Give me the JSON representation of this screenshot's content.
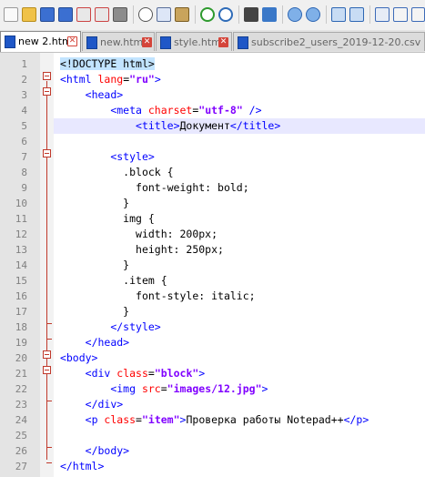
{
  "toolbar": {
    "icons": [
      "new-file",
      "open-file",
      "save",
      "save-all",
      "close",
      "close-all",
      "print",
      "cut",
      "copy",
      "paste",
      "undo",
      "redo",
      "find",
      "replace",
      "zoom-in",
      "zoom-out",
      "sync-v",
      "sync-h"
    ]
  },
  "tabs": [
    {
      "label": "new 2.html",
      "active": true
    },
    {
      "label": "new.html",
      "active": false
    },
    {
      "label": "style.html",
      "active": false
    },
    {
      "label": "subscribe2_users_2019-12-20.csv",
      "active": false
    }
  ],
  "editor": {
    "current_line": 5,
    "lines": [
      {
        "n": "1",
        "tokens": [
          {
            "t": "<!DOCTYPE html>",
            "c": "doctype"
          }
        ]
      },
      {
        "n": "2",
        "tokens": [
          {
            "t": "<html ",
            "c": "tag"
          },
          {
            "t": "lang",
            "c": "attr"
          },
          {
            "t": "=",
            "c": "plain"
          },
          {
            "t": "\"ru\"",
            "c": "val"
          },
          {
            "t": ">",
            "c": "tag"
          }
        ]
      },
      {
        "n": "3",
        "tokens": [
          {
            "t": "    ",
            "c": "plain"
          },
          {
            "t": "<head>",
            "c": "tag"
          }
        ]
      },
      {
        "n": "4",
        "tokens": [
          {
            "t": "        ",
            "c": "plain"
          },
          {
            "t": "<meta ",
            "c": "tag"
          },
          {
            "t": "charset",
            "c": "attr"
          },
          {
            "t": "=",
            "c": "plain"
          },
          {
            "t": "\"utf-8\"",
            "c": "val"
          },
          {
            "t": " />",
            "c": "tag"
          }
        ]
      },
      {
        "n": "5",
        "tokens": [
          {
            "t": "            ",
            "c": "plain"
          },
          {
            "t": "<title>",
            "c": "tag"
          },
          {
            "t": "Документ",
            "c": "plain"
          },
          {
            "t": "</title>",
            "c": "tag"
          }
        ]
      },
      {
        "n": "6",
        "tokens": []
      },
      {
        "n": "7",
        "tokens": [
          {
            "t": "        ",
            "c": "plain"
          },
          {
            "t": "<style>",
            "c": "tag"
          }
        ]
      },
      {
        "n": "8",
        "tokens": [
          {
            "t": "          .block {",
            "c": "css"
          }
        ]
      },
      {
        "n": "9",
        "tokens": [
          {
            "t": "            font-weight: bold;",
            "c": "css"
          }
        ]
      },
      {
        "n": "10",
        "tokens": [
          {
            "t": "          }",
            "c": "css"
          }
        ]
      },
      {
        "n": "11",
        "tokens": [
          {
            "t": "          img {",
            "c": "css"
          }
        ]
      },
      {
        "n": "12",
        "tokens": [
          {
            "t": "            width: 200px;",
            "c": "css"
          }
        ]
      },
      {
        "n": "13",
        "tokens": [
          {
            "t": "            height: 250px;",
            "c": "css"
          }
        ]
      },
      {
        "n": "14",
        "tokens": [
          {
            "t": "          }",
            "c": "css"
          }
        ]
      },
      {
        "n": "15",
        "tokens": [
          {
            "t": "          .item {",
            "c": "css"
          }
        ]
      },
      {
        "n": "16",
        "tokens": [
          {
            "t": "            font-style: italic;",
            "c": "css"
          }
        ]
      },
      {
        "n": "17",
        "tokens": [
          {
            "t": "          }",
            "c": "css"
          }
        ]
      },
      {
        "n": "18",
        "tokens": [
          {
            "t": "        ",
            "c": "plain"
          },
          {
            "t": "</style>",
            "c": "tag"
          }
        ]
      },
      {
        "n": "19",
        "tokens": [
          {
            "t": "    ",
            "c": "plain"
          },
          {
            "t": "</head>",
            "c": "tag"
          }
        ]
      },
      {
        "n": "20",
        "tokens": [
          {
            "t": "<body>",
            "c": "tag"
          }
        ]
      },
      {
        "n": "21",
        "tokens": [
          {
            "t": "    ",
            "c": "plain"
          },
          {
            "t": "<div ",
            "c": "tag"
          },
          {
            "t": "class",
            "c": "attr"
          },
          {
            "t": "=",
            "c": "plain"
          },
          {
            "t": "\"block\"",
            "c": "val"
          },
          {
            "t": ">",
            "c": "tag"
          }
        ]
      },
      {
        "n": "22",
        "tokens": [
          {
            "t": "        ",
            "c": "plain"
          },
          {
            "t": "<img ",
            "c": "tag"
          },
          {
            "t": "src",
            "c": "attr"
          },
          {
            "t": "=",
            "c": "plain"
          },
          {
            "t": "\"images/12.jpg\"",
            "c": "val"
          },
          {
            "t": ">",
            "c": "tag"
          }
        ]
      },
      {
        "n": "23",
        "tokens": [
          {
            "t": "    ",
            "c": "plain"
          },
          {
            "t": "</div>",
            "c": "tag"
          }
        ]
      },
      {
        "n": "24",
        "tokens": [
          {
            "t": "    ",
            "c": "plain"
          },
          {
            "t": "<p ",
            "c": "tag"
          },
          {
            "t": "class",
            "c": "attr"
          },
          {
            "t": "=",
            "c": "plain"
          },
          {
            "t": "\"item\"",
            "c": "val"
          },
          {
            "t": ">",
            "c": "tag"
          },
          {
            "t": "Проверка работы Notepad++",
            "c": "plain"
          },
          {
            "t": "</p>",
            "c": "tag"
          }
        ]
      },
      {
        "n": "25",
        "tokens": []
      },
      {
        "n": "26",
        "tokens": [
          {
            "t": "    ",
            "c": "plain"
          },
          {
            "t": "</body>",
            "c": "tag"
          }
        ]
      },
      {
        "n": "27",
        "tokens": [
          {
            "t": "</html>",
            "c": "tag"
          }
        ]
      }
    ]
  }
}
